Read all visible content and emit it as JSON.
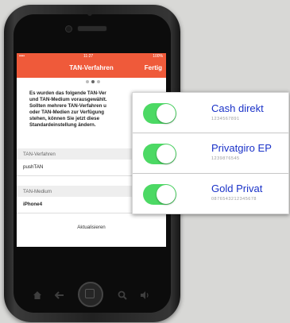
{
  "statusbar": {
    "carrier": "•••• ",
    "time": "11:27",
    "battery": "100%"
  },
  "navbar": {
    "title": "TAN-Verfahren",
    "done_label": "Fertig"
  },
  "info_text": "Es wurden das folgende TAN-Ver\nund TAN-Medium vorausgewählt.\nSollten mehrere TAN-Verfahren u\noder TAN-Medien zur Verfügung\nstehen, können Sie jetzt diese\nStandardeinstellung ändern.",
  "sections": {
    "verfahren_header": "TAN-Verfahren",
    "verfahren_value": "pushTAN",
    "medium_header": "TAN-Medium",
    "medium_value": "iPhone4",
    "update_button": "Aktualisieren"
  },
  "accounts": [
    {
      "name": "Cash direkt",
      "number": "1234567891",
      "enabled": true
    },
    {
      "name": "Privatgiro EP",
      "number": "1239876545",
      "enabled": true
    },
    {
      "name": "Gold Privat",
      "number": "0876543212345678",
      "enabled": true
    }
  ],
  "colors": {
    "accent": "#ef5a3a",
    "toggle_on": "#4cd964",
    "account_name": "#1a32c8"
  },
  "icons": [
    "home-icon",
    "back-icon",
    "search-icon",
    "volume-icon"
  ]
}
